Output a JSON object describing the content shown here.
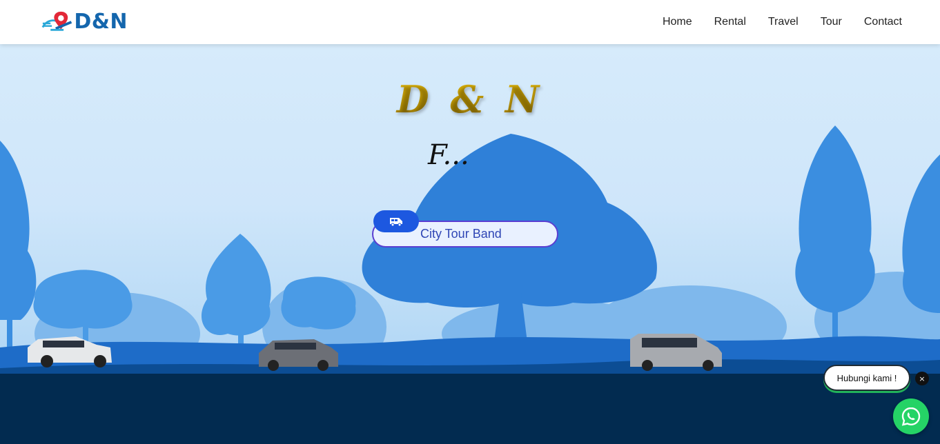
{
  "navbar": {
    "logo_text": "D&N",
    "links": [
      {
        "label": "Home"
      },
      {
        "label": "Rental"
      },
      {
        "label": "Travel"
      },
      {
        "label": "Tour"
      },
      {
        "label": "Contact"
      }
    ]
  },
  "hero": {
    "title": "D & N",
    "script_text": "F...",
    "service_label": "City Tour Band",
    "service_icon": "van-icon"
  },
  "contact": {
    "bubble_text": "Hubungi kami !",
    "close_label": "×",
    "whatsapp_icon": "whatsapp-icon"
  },
  "colors": {
    "brand_blue": "#1466ad",
    "brand_gold": "#c9a100",
    "pill_accent": "#1d58e0",
    "ground_navy": "#022b50",
    "whatsapp_green": "#25d366"
  }
}
